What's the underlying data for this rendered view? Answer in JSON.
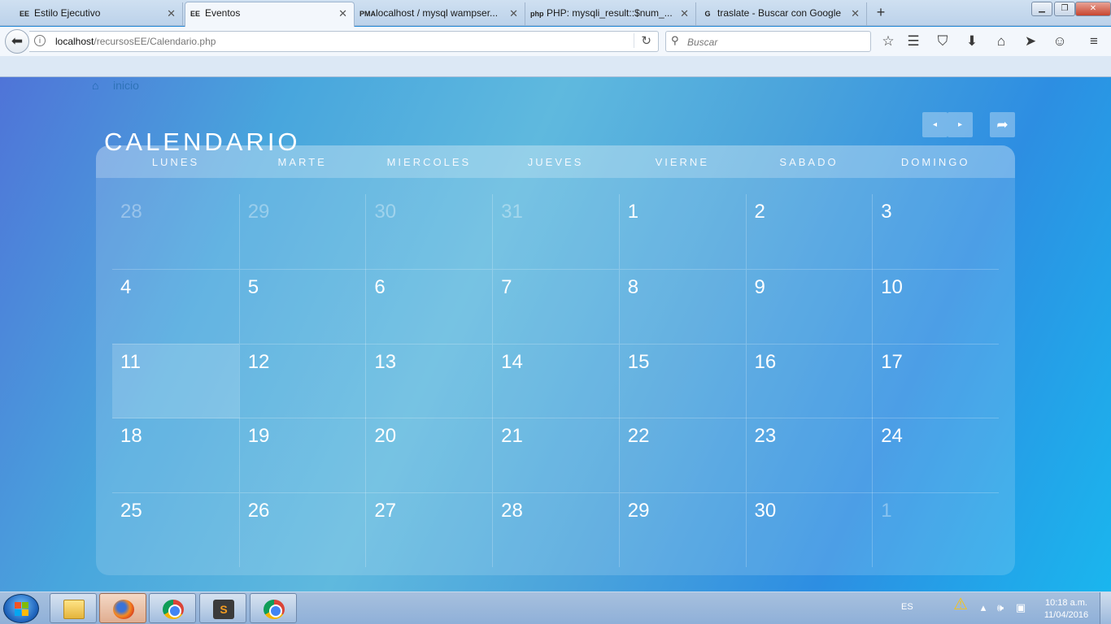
{
  "browser": {
    "tabs": [
      {
        "favicon": "EE",
        "title": "Estilo Ejecutivo"
      },
      {
        "favicon": "EE",
        "title": "Eventos"
      },
      {
        "favicon": "PMA",
        "title": "localhost / mysql wampser..."
      },
      {
        "favicon": "php",
        "title": "PHP: mysqli_result::$num_..."
      },
      {
        "favicon": "G",
        "title": "traslate - Buscar con Google"
      }
    ],
    "active_tab": 1,
    "new_tab_label": "+",
    "url_host": "localhost",
    "url_path": "/recursosEE/Calendario.php",
    "search_placeholder": "Buscar",
    "toolbar_icons": [
      "bookmark-star-icon",
      "reader-list-icon",
      "pocket-icon",
      "download-icon",
      "home-icon",
      "share-icon",
      "emoji-icon",
      "menu-icon"
    ]
  },
  "page": {
    "breadcrumb": "inicio",
    "title": "CALENDARIO",
    "nav": {
      "prev": "◂",
      "next": "▸",
      "go": "➦"
    },
    "weekdays": [
      "LUNES",
      "MARTE",
      "MIERCOLES",
      "JUEVES",
      "VIERNE",
      "SABADO",
      "DOMINGO"
    ],
    "weeks": [
      [
        {
          "d": "28",
          "other": true
        },
        {
          "d": "29",
          "other": true
        },
        {
          "d": "30",
          "other": true
        },
        {
          "d": "31",
          "other": true
        },
        {
          "d": "1"
        },
        {
          "d": "2"
        },
        {
          "d": "3"
        }
      ],
      [
        {
          "d": "4"
        },
        {
          "d": "5"
        },
        {
          "d": "6"
        },
        {
          "d": "7"
        },
        {
          "d": "8"
        },
        {
          "d": "9"
        },
        {
          "d": "10"
        }
      ],
      [
        {
          "d": "11",
          "today": true
        },
        {
          "d": "12"
        },
        {
          "d": "13"
        },
        {
          "d": "14"
        },
        {
          "d": "15"
        },
        {
          "d": "16"
        },
        {
          "d": "17"
        }
      ],
      [
        {
          "d": "18"
        },
        {
          "d": "19"
        },
        {
          "d": "20"
        },
        {
          "d": "21"
        },
        {
          "d": "22"
        },
        {
          "d": "23"
        },
        {
          "d": "24"
        }
      ],
      [
        {
          "d": "25"
        },
        {
          "d": "26"
        },
        {
          "d": "27"
        },
        {
          "d": "28"
        },
        {
          "d": "29"
        },
        {
          "d": "30"
        },
        {
          "d": "1",
          "other": true
        }
      ]
    ]
  },
  "taskbar": {
    "apps": [
      "file-explorer",
      "firefox",
      "chrome",
      "sublime-text",
      "chrome"
    ],
    "active_app": 1,
    "language": "ES",
    "time": "10:18 a.m.",
    "date": "11/04/2016"
  },
  "colors": {
    "page_gradient_start": "#4f74d8",
    "page_gradient_end": "#1ab6ee",
    "text": "#ffffff"
  }
}
